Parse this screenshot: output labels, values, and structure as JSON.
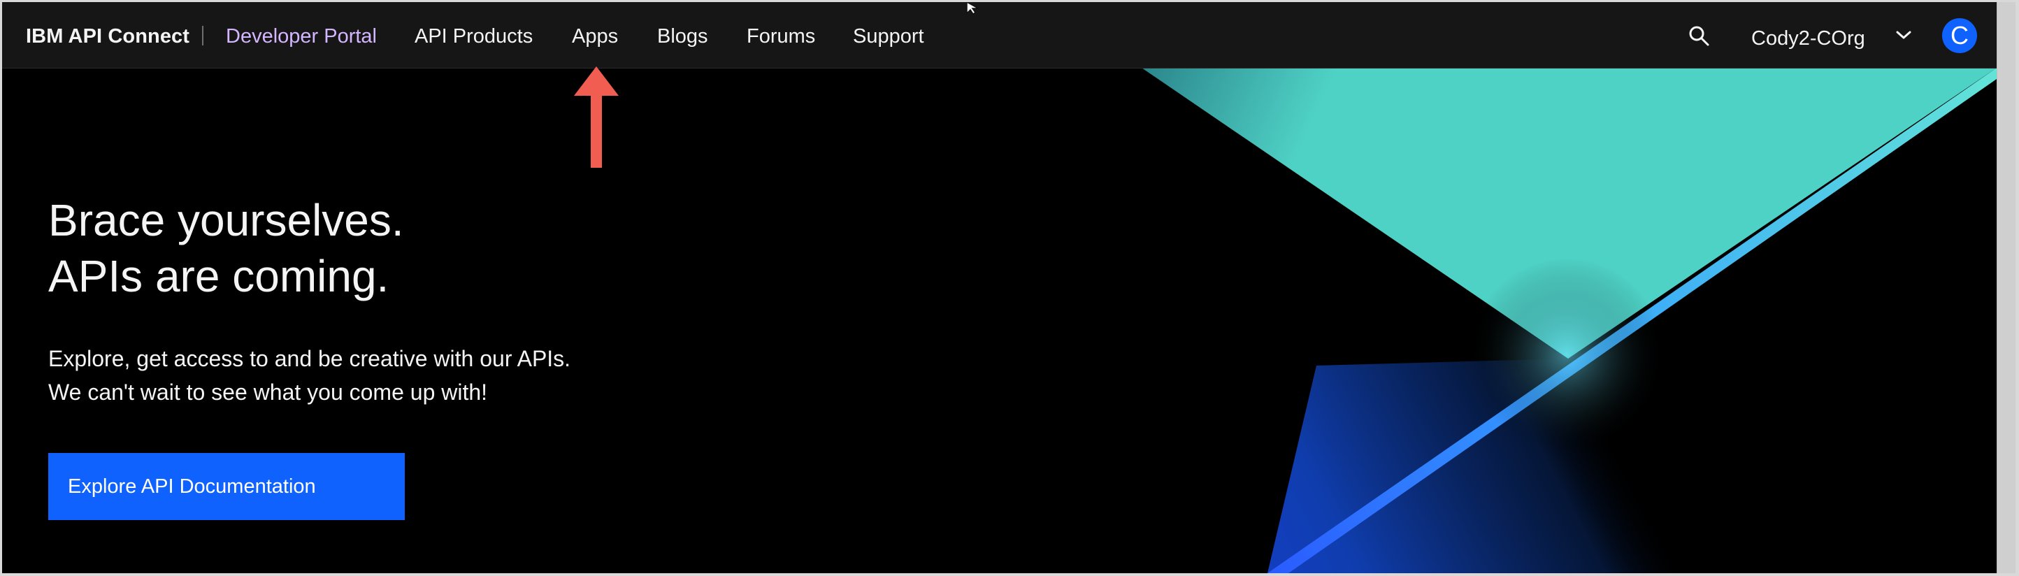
{
  "header": {
    "brand": "IBM API Connect",
    "portal_name": "Developer Portal",
    "nav": [
      {
        "label": "API Products"
      },
      {
        "label": "Apps"
      },
      {
        "label": "Blogs"
      },
      {
        "label": "Forums"
      },
      {
        "label": "Support"
      }
    ],
    "search_icon": "search-icon",
    "org_name": "Cody2-COrg",
    "dropdown_icon": "chevron-down-icon",
    "avatar_initial": "C"
  },
  "hero": {
    "title_line1": "Brace yourselves.",
    "title_line2": "APIs are coming.",
    "subtitle_line1": "Explore, get access to and be creative with our APIs.",
    "subtitle_line2": "We can't wait to see what you come up with!",
    "cta_label": "Explore API Documentation"
  },
  "annotations": {
    "arrow_icon": "annotation-arrow-icon",
    "cursor_icon": "mouse-pointer-icon"
  },
  "colors": {
    "header_bg": "#161616",
    "page_bg": "#000000",
    "portal_accent": "#d4b5ff",
    "primary_button": "#0f62fe",
    "annotation_arrow": "#f25d52",
    "graphic_teal": "#4fd2c6",
    "graphic_blue": "#2a5bff"
  }
}
